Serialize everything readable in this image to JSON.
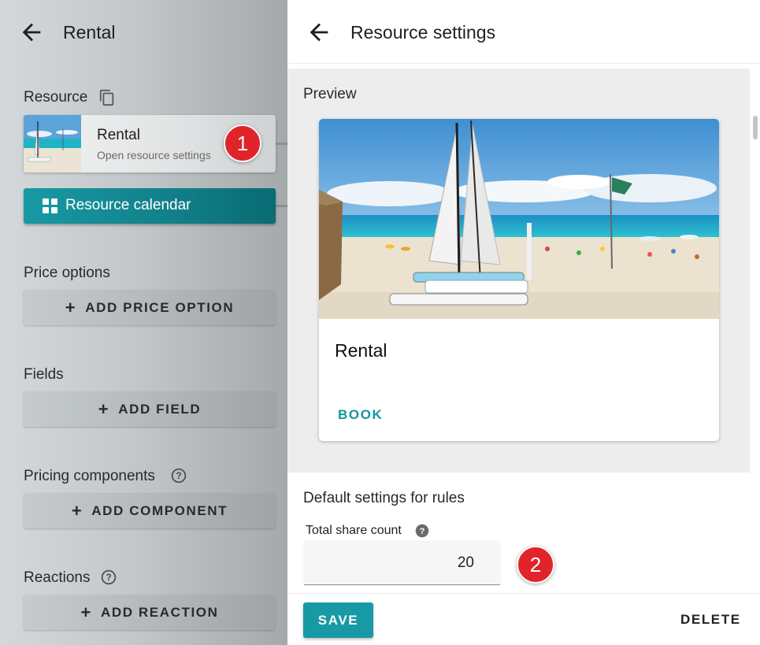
{
  "left_panel": {
    "title": "Rental",
    "resource_label": "Resource",
    "resource_card": {
      "name": "Rental",
      "subtitle": "Open resource settings"
    },
    "calendar_button": "Resource calendar",
    "sections": [
      {
        "label": "Price options",
        "button": "ADD PRICE OPTION"
      },
      {
        "label": "Fields",
        "button": "ADD FIELD"
      },
      {
        "label": "Pricing components",
        "button": "ADD COMPONENT"
      },
      {
        "label": "Reactions",
        "button": "ADD REACTION"
      }
    ]
  },
  "right_panel": {
    "title": "Resource settings",
    "preview_label": "Preview",
    "preview_card": {
      "name": "Rental",
      "action": "BOOK"
    },
    "defaults_label": "Default settings for rules",
    "total_share_count": {
      "label": "Total share count",
      "value": "20"
    },
    "save_button": "SAVE",
    "delete_button": "DELETE"
  },
  "annotations": {
    "badge_1": "1",
    "badge_2": "2"
  },
  "colors": {
    "accent": "#179aa4",
    "badge": "#e0242a"
  },
  "icons": [
    "back-arrow-icon",
    "copy-icon",
    "grid-icon",
    "plus-icon",
    "help-icon"
  ]
}
